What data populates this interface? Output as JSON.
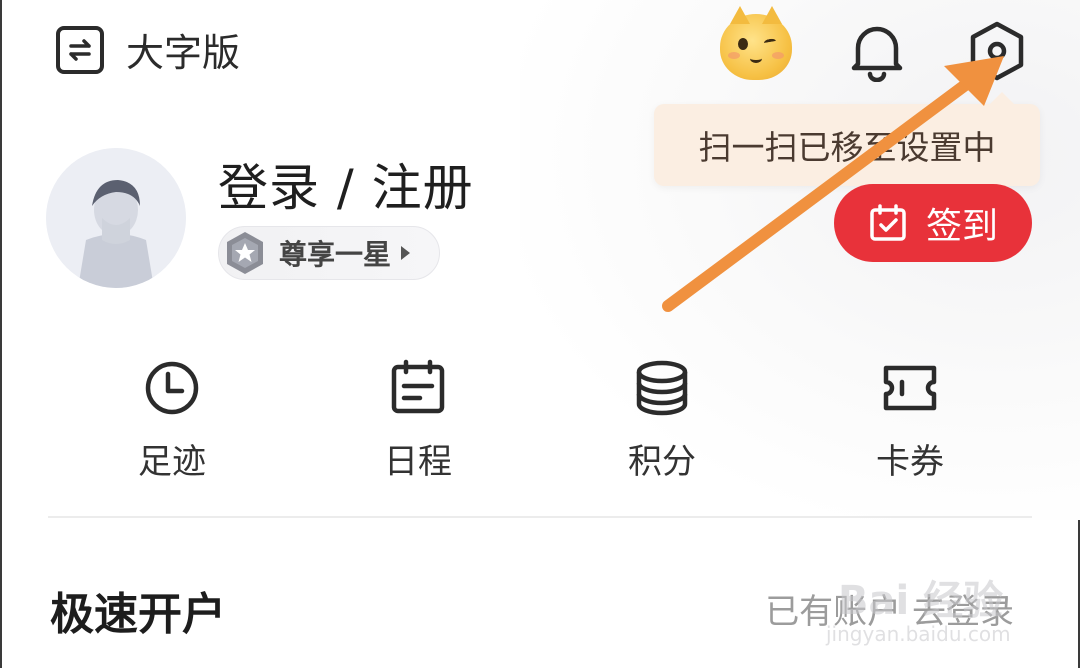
{
  "header": {
    "mode_label": "大字版",
    "icons": {
      "mode_switch": "switch-icon",
      "mascot": "mascot-icon",
      "notifications": "bell-icon",
      "settings": "gear-icon"
    }
  },
  "tooltip": {
    "text": "扫一扫已移至设置中"
  },
  "profile": {
    "login_text": "登录 / 注册",
    "vip_label": "尊享一星"
  },
  "checkin": {
    "label": "签到",
    "color": "#e8323a"
  },
  "quick_actions": [
    {
      "label": "足迹",
      "icon": "clock-icon"
    },
    {
      "label": "日程",
      "icon": "calendar-icon"
    },
    {
      "label": "积分",
      "icon": "coins-icon"
    },
    {
      "label": "卡券",
      "icon": "ticket-icon"
    }
  ],
  "account_section": {
    "title": "极速开户",
    "link_text": "已有账户 去登录"
  },
  "watermark": {
    "brand": "Bai 经验",
    "url": "jingyan.baidu.com"
  },
  "colors": {
    "accent_arrow": "#f0913f",
    "tooltip_bg": "#fbeee2",
    "primary_red": "#e8323a"
  }
}
